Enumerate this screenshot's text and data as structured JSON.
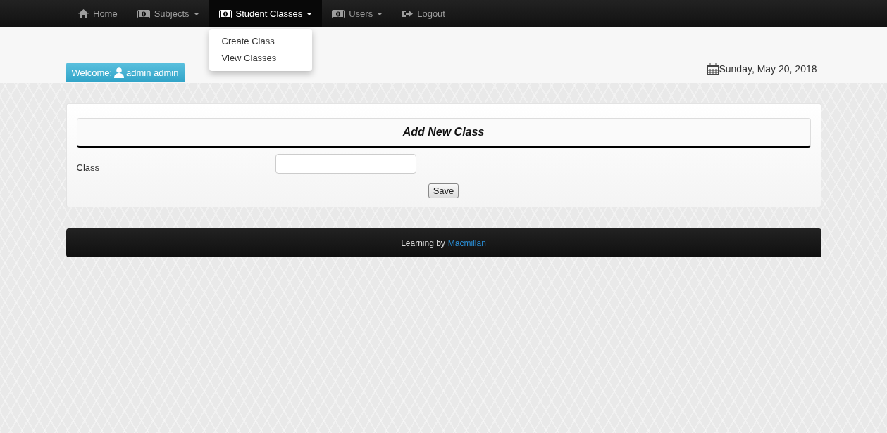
{
  "navbar": {
    "items": [
      {
        "label": "Home",
        "kind": "home",
        "dropdown": false,
        "selected": false
      },
      {
        "label": "Subjects",
        "kind": "money",
        "dropdown": true,
        "selected": false
      },
      {
        "label": "Student Classes",
        "kind": "money",
        "dropdown": true,
        "selected": true,
        "menu": [
          "Create Class",
          "View Classes"
        ]
      },
      {
        "label": "Users",
        "kind": "money",
        "dropdown": true,
        "selected": false
      },
      {
        "label": "Logout",
        "kind": "logout",
        "dropdown": false,
        "selected": false
      }
    ]
  },
  "welcome": {
    "prefix": "Welcome:",
    "user": "admin admin"
  },
  "date": "Sunday, May 20, 2018",
  "form": {
    "title": "Add New Class",
    "field_label": "Class",
    "button": "Save"
  },
  "footer": {
    "text": "Learning by",
    "link": "Macmillan"
  }
}
